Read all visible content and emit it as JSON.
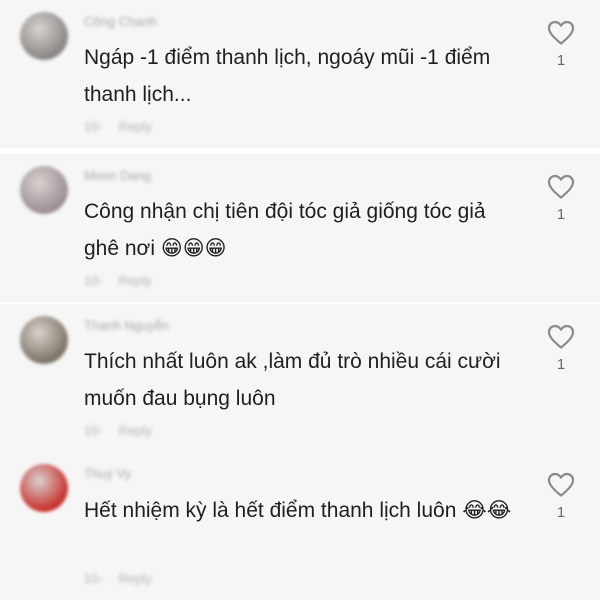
{
  "comments": [
    {
      "username": "Công Chanh",
      "text": "Ngáp -1 điểm thanh lịch, ngoáy mũi -1 điểm thanh lịch...",
      "emoji": "",
      "time": "10-",
      "reply_label": "Reply",
      "likes": "1",
      "avatar_color": "#8a8684"
    },
    {
      "username": "Moon Dang",
      "text": "Công nhận chị tiên đội tóc giả giống tóc giả ghê nơi",
      "emoji": "😁😁😁",
      "time": "10-",
      "reply_label": "Reply",
      "likes": "1",
      "avatar_color": "#9c8f93"
    },
    {
      "username": "Thanh Nguyễn",
      "text": "Thích nhất luôn ak ,làm đủ trò nhiều cái cười muốn đau bụng luôn",
      "emoji": "",
      "time": "10-",
      "reply_label": "Reply",
      "likes": "1",
      "avatar_color": "#7d7466"
    },
    {
      "username": "Thuý Vy",
      "text": "Hết nhiệm kỳ là hết điểm thanh lịch luôn",
      "emoji": "😂😂",
      "time": "10-",
      "reply_label": "Reply",
      "likes": "1",
      "avatar_color": "#c9302c"
    }
  ]
}
